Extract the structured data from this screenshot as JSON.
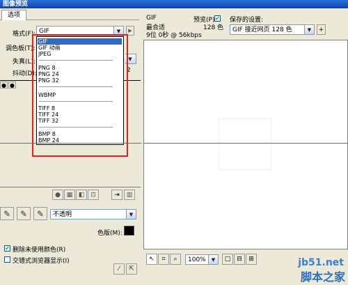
{
  "window": {
    "title": "图像预览"
  },
  "tabs": [
    {
      "label": "选项"
    }
  ],
  "left": {
    "format_label": "格式(F):",
    "format_value": "GIF",
    "palette_label": "调色板(T):",
    "loss_label": "失真(L):",
    "dither_label": "抖动(D):",
    "dither_value_hint": "2",
    "format_options": [
      "GIF",
      "GIF 动画",
      "JPEG",
      "PNG 8",
      "PNG 24",
      "PNG 32",
      "WBMP",
      "TIFF 8",
      "TIFF 24",
      "TIFF 32",
      "BMP 8",
      "BMP 24"
    ],
    "transparency_value": "不透明",
    "matte_label": "色版(M):",
    "remove_unused_label": "删除未使用颜色(R)",
    "interlace_label": "交错式浏览器显示(I)",
    "remove_unused_checked": true,
    "interlace_checked": false
  },
  "right": {
    "format_name": "GIF",
    "fit_label": "最合适",
    "info_line": "9位 0秒 @ 56kbps",
    "preview_label": "预览(P)",
    "preview_checked": true,
    "colors_count": "128 色",
    "saved_settings_label": "保存的设置:",
    "saved_settings_value": "GIF 接近网页 128 色",
    "add_button": "+",
    "zoom_value": "100%"
  },
  "watermark": {
    "site": "jb51.net",
    "name": "脚本之家"
  },
  "colors": {
    "highlight": "#e02020",
    "selected_option": "#316ac5",
    "matte_swatch": "#000000"
  }
}
